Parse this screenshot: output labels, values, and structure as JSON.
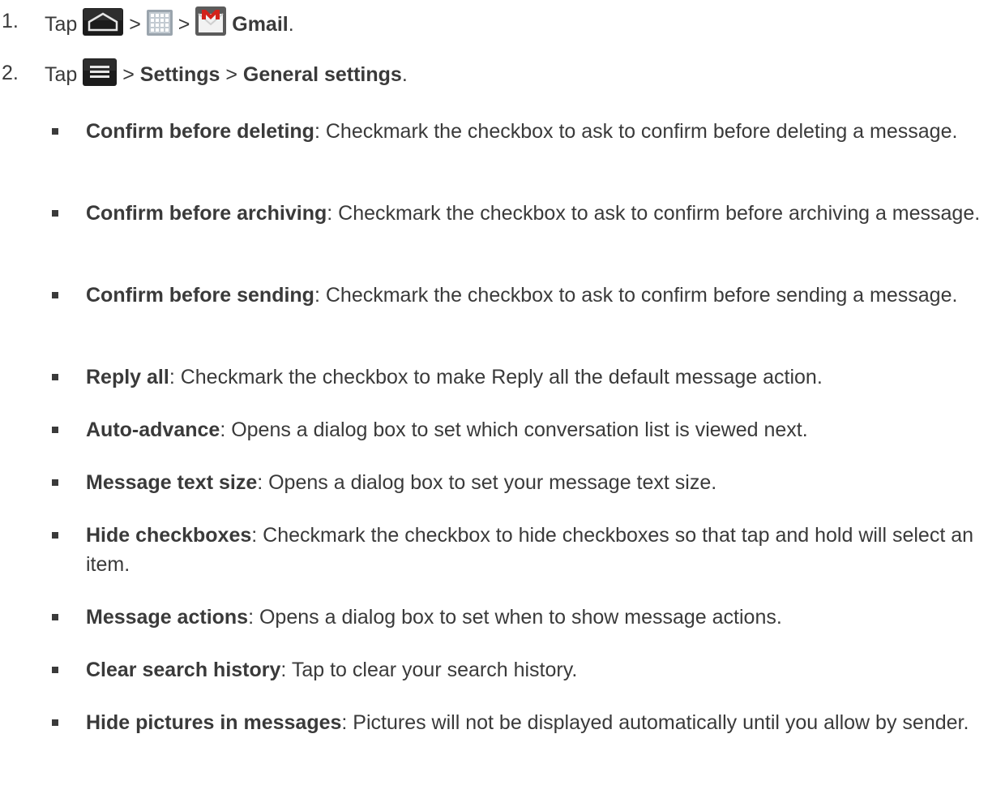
{
  "steps": [
    {
      "number": "1.",
      "tap": "Tap",
      "sep": ">",
      "icons": [
        "home-icon",
        "apps-grid-icon",
        "gmail-icon"
      ],
      "target": "Gmail",
      "end": "."
    },
    {
      "number": "2.",
      "tap": "Tap",
      "sep": ">",
      "icons": [
        "menu-icon"
      ],
      "settings": "Settings",
      "general": "General settings",
      "end": "."
    }
  ],
  "options": [
    {
      "title": "Confirm before deleting",
      "desc": ": Checkmark the checkbox to ask to confirm before deleting a message."
    },
    {
      "title": "Confirm before archiving",
      "desc": ": Checkmark the checkbox to ask to confirm before archiving a message."
    },
    {
      "title": "Confirm before sending",
      "desc": ": Checkmark the checkbox to ask to confirm before sending a message."
    },
    {
      "title": "Reply all",
      "desc": ": Checkmark the checkbox to make Reply all the default message action."
    },
    {
      "title": "Auto-advance",
      "desc": ": Opens a dialog box to set which conversation list is viewed next."
    },
    {
      "title": "Message text size",
      "desc": ": Opens a dialog box to set your message text size."
    },
    {
      "title": "Hide checkboxes",
      "desc": ": Checkmark the checkbox to hide checkboxes so that tap and hold will select an item."
    },
    {
      "title": "Message actions",
      "desc": ": Opens a dialog box to set when to show message actions."
    },
    {
      "title": "Clear search history",
      "desc": ": Tap to clear your search history."
    },
    {
      "title": "Hide pictures in messages",
      "desc": ": Pictures will not be displayed automatically until you allow by sender."
    }
  ],
  "colors": {
    "text": "#3a3a3a",
    "gmail_red": "#d2231b"
  }
}
